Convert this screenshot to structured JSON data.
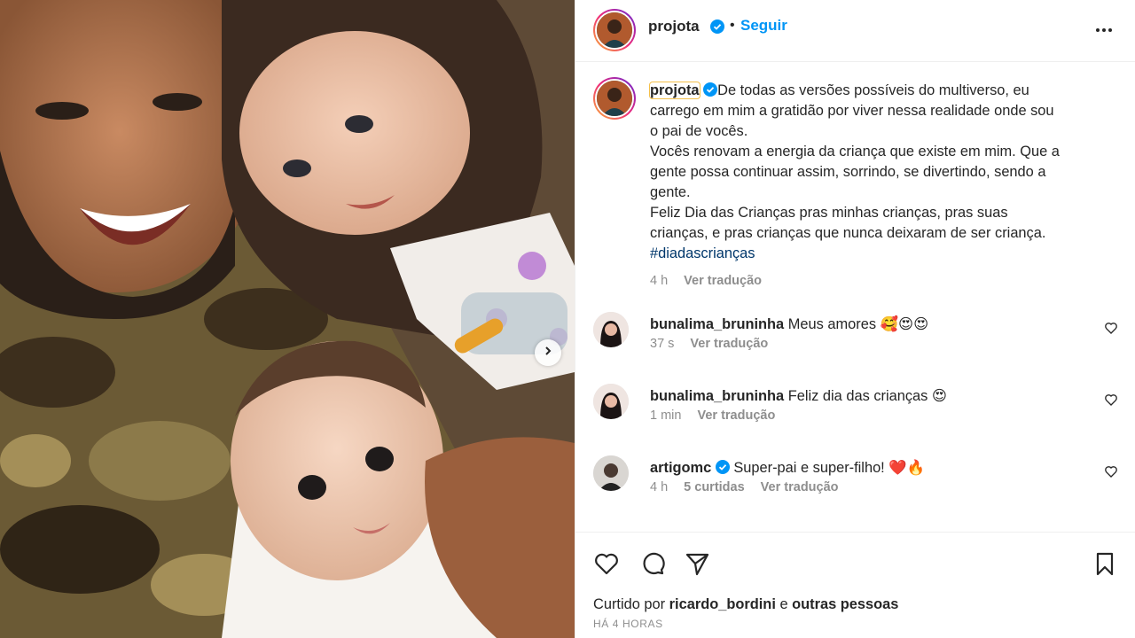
{
  "post": {
    "author": "projota",
    "follow_label": "Seguir",
    "separator": "•",
    "caption_lines": [
      "De todas as versões possíveis do multiverso, eu",
      "carrego em mim a gratidão por viver nessa realidade onde sou",
      "o pai de vocês.",
      "Vocês renovam a energia da criança que existe em mim. Que a",
      "gente possa continuar assim, sorrindo, se divertindo, sendo a",
      "gente.",
      "Feliz Dia das Crianças pras minhas crianças, pras suas",
      "crianças, e pras crianças que nunca deixaram de ser criança."
    ],
    "hashtag": "#diadascrianças",
    "caption_time": "4 h",
    "translate_label": "Ver tradução"
  },
  "comments": [
    {
      "user": "bunalima_bruninha",
      "text": "Meus amores 🥰😍😍",
      "time": "37 s",
      "likes": "",
      "translate": "Ver tradução",
      "verified": false
    },
    {
      "user": "bunalima_bruninha",
      "text": "Feliz dia das crianças 😍",
      "time": "1 min",
      "likes": "",
      "translate": "Ver tradução",
      "verified": false
    },
    {
      "user": "artigomc",
      "text": "Super-pai e super-filho! ❤️🔥",
      "time": "4 h",
      "likes": "5 curtidas",
      "translate": "Ver tradução",
      "verified": true
    }
  ],
  "footer": {
    "liked_prefix": "Curtido por",
    "liked_user": "ricardo_bordini",
    "liked_joiner": "e",
    "liked_others": "outras pessoas",
    "timestamp": "HÁ 4 HORAS"
  },
  "icons": {
    "verified": "verified-badge-icon",
    "more": "more-options-icon",
    "like": "heart-icon",
    "comment": "comment-icon",
    "share": "send-icon",
    "save": "bookmark-icon",
    "next": "chevron-right-icon"
  },
  "colors": {
    "accent": "#0095f6",
    "verified": "#0095f6",
    "hashtag": "#00376b",
    "muted": "#8e8e8e",
    "text": "#262626"
  }
}
